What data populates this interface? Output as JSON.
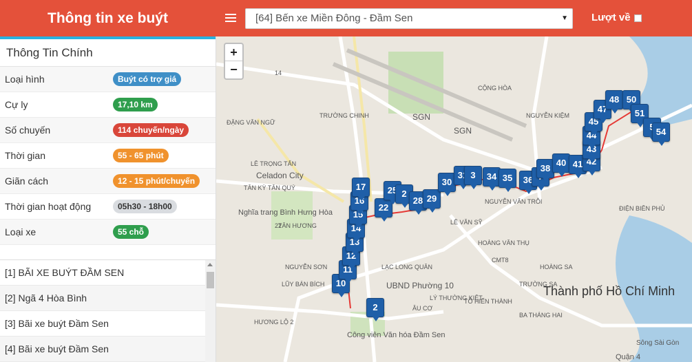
{
  "header": {
    "title": "Thông tin xe buýt",
    "route_selected": "[64] Bến xe Miền Đông - Đầm Sen",
    "return_label": "Lượt về"
  },
  "info": {
    "title": "Thông Tin Chính",
    "rows": [
      {
        "label": "Loại hình",
        "value": "Buýt có trợ giá",
        "color": "#3f8fc7"
      },
      {
        "label": "Cự ly",
        "value": "17,10 km",
        "color": "#2f9e4d"
      },
      {
        "label": "Số chuyến",
        "value": "114 chuyến/ngày",
        "color": "#d9463a"
      },
      {
        "label": "Thời gian",
        "value": "55 - 65 phút",
        "color": "#f0922d"
      },
      {
        "label": "Giãn cách",
        "value": "12 - 15 phút/chuyến",
        "color": "#f0922d"
      },
      {
        "label": "Thời gian hoạt động",
        "value": "05h30 - 18h00",
        "color": "#d9dce0",
        "text_color": "#333"
      },
      {
        "label": "Loại xe",
        "value": "55 chỗ",
        "color": "#2f9e4d"
      }
    ]
  },
  "stops": [
    "[1] BÃI XE BUÝT ĐẦM SEN",
    "[2] Ngã 4 Hòa Bình",
    "[3] Bãi xe buýt Đầm Sen",
    "[4] Bãi xe buýt Đầm Sen"
  ],
  "map": {
    "zoom_in": "+",
    "zoom_out": "−",
    "labels": [
      "SGN",
      "SGN",
      "Celadon City",
      "Nghĩa trang Bình Hưng Hòa",
      "UBND Phường 10",
      "Thành phố Hồ Chí Minh",
      "Công viên Văn hóa Đầm Sen",
      "Quận 4",
      "TRƯỜNG CHINH",
      "CỘNG HÒA",
      "HOÀNG VĂN THỤ",
      "NGUYỄN VĂN TRỖI",
      "LÊ VĂN SỸ",
      "ÂU CƠ",
      "LŨY BÁN BÍCH",
      "LẠC LONG QUÂN",
      "BA THÁNG HAI",
      "TÔ HIẾN THÀNH",
      "CMT8",
      "HOÀNG SA",
      "TRƯỜNG SA",
      "LÊ TRỌNG TẤN",
      "TÂN KỲ TÂN QUÝ",
      "HƯƠNG LỘ 2",
      "ĐIỆN BIÊN PHỦ",
      "NGUYỄN SƠN",
      "TÂN HƯƠNG",
      "LÝ THƯỜNG KIỆT",
      "Sông Sài Gòn",
      "14",
      "22",
      "ĐẶNG VĂN NGỮ",
      "NGUYỄN KIỆM"
    ],
    "markers": [
      {
        "n": "2"
      },
      {
        "n": "10"
      },
      {
        "n": "11"
      },
      {
        "n": "12"
      },
      {
        "n": "13"
      },
      {
        "n": "14"
      },
      {
        "n": "15"
      },
      {
        "n": "16"
      },
      {
        "n": "17"
      },
      {
        "n": "22"
      },
      {
        "n": "25"
      },
      {
        "n": "2"
      },
      {
        "n": "28"
      },
      {
        "n": "29"
      },
      {
        "n": "30"
      },
      {
        "n": "31"
      },
      {
        "n": "3"
      },
      {
        "n": "34"
      },
      {
        "n": "35"
      },
      {
        "n": "36"
      },
      {
        "n": "7"
      },
      {
        "n": "38"
      },
      {
        "n": "40"
      },
      {
        "n": "41"
      },
      {
        "n": "42"
      },
      {
        "n": "43"
      },
      {
        "n": "44"
      },
      {
        "n": "45"
      },
      {
        "n": "47"
      },
      {
        "n": "48"
      },
      {
        "n": "50"
      },
      {
        "n": "51"
      },
      {
        "n": "5"
      },
      {
        "n": "54"
      }
    ]
  }
}
